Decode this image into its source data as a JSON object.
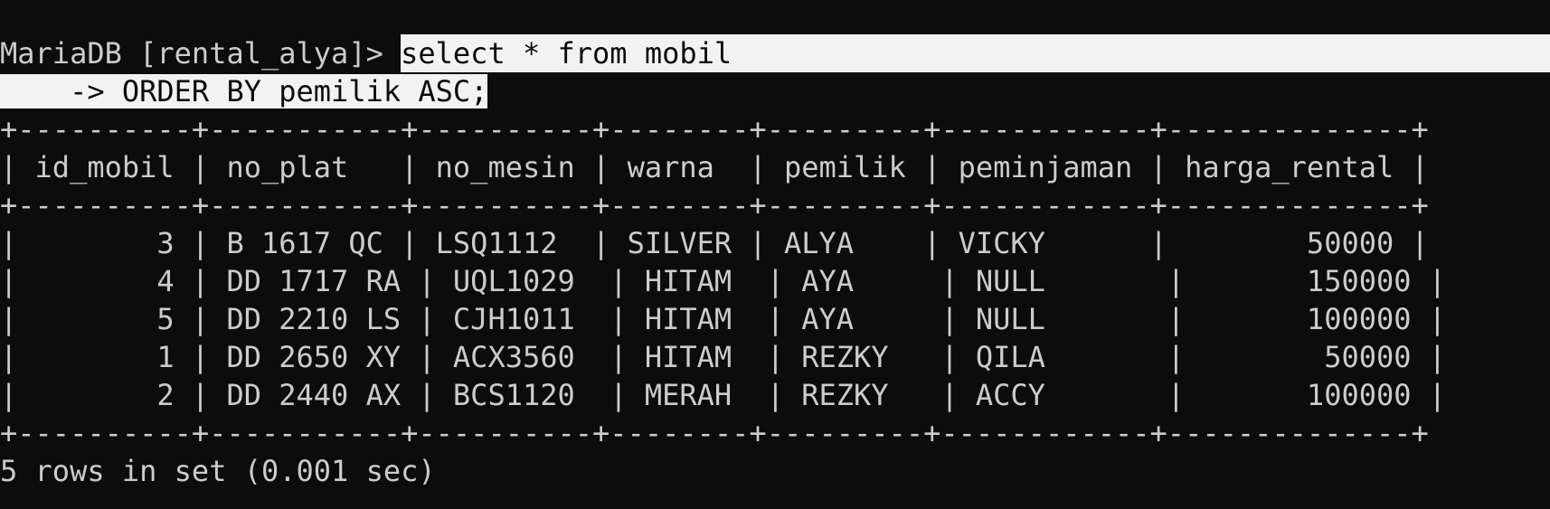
{
  "prompt": "MariaDB [rental_alya]> ",
  "query_line1": "select * from mobil",
  "query_line2": "    -> ORDER BY pemilik ASC;",
  "border": "+----------+-----------+----------+--------+---------+------------+--------------+",
  "header_row": "| id_mobil | no_plat   | no_mesin | warna  | pemilik | peminjaman | harga_rental |",
  "rows": [
    "|        3 | B 1617 QC | LSQ1112  | SILVER | ALYA    | VICKY      |        50000 |",
    "|        4 | DD 1717 RA | UQL1029  | HITAM  | AYA     | NULL       |       150000 |",
    "|        5 | DD 2210 LS | CJH1011  | HITAM  | AYA     | NULL       |       100000 |",
    "|        1 | DD 2650 XY | ACX3560  | HITAM  | REZKY   | QILA       |        50000 |",
    "|        2 | DD 2440 AX | BCS1120  | MERAH  | REZKY   | ACCY       |       100000 |"
  ],
  "status": "5 rows in set (0.001 sec)"
}
